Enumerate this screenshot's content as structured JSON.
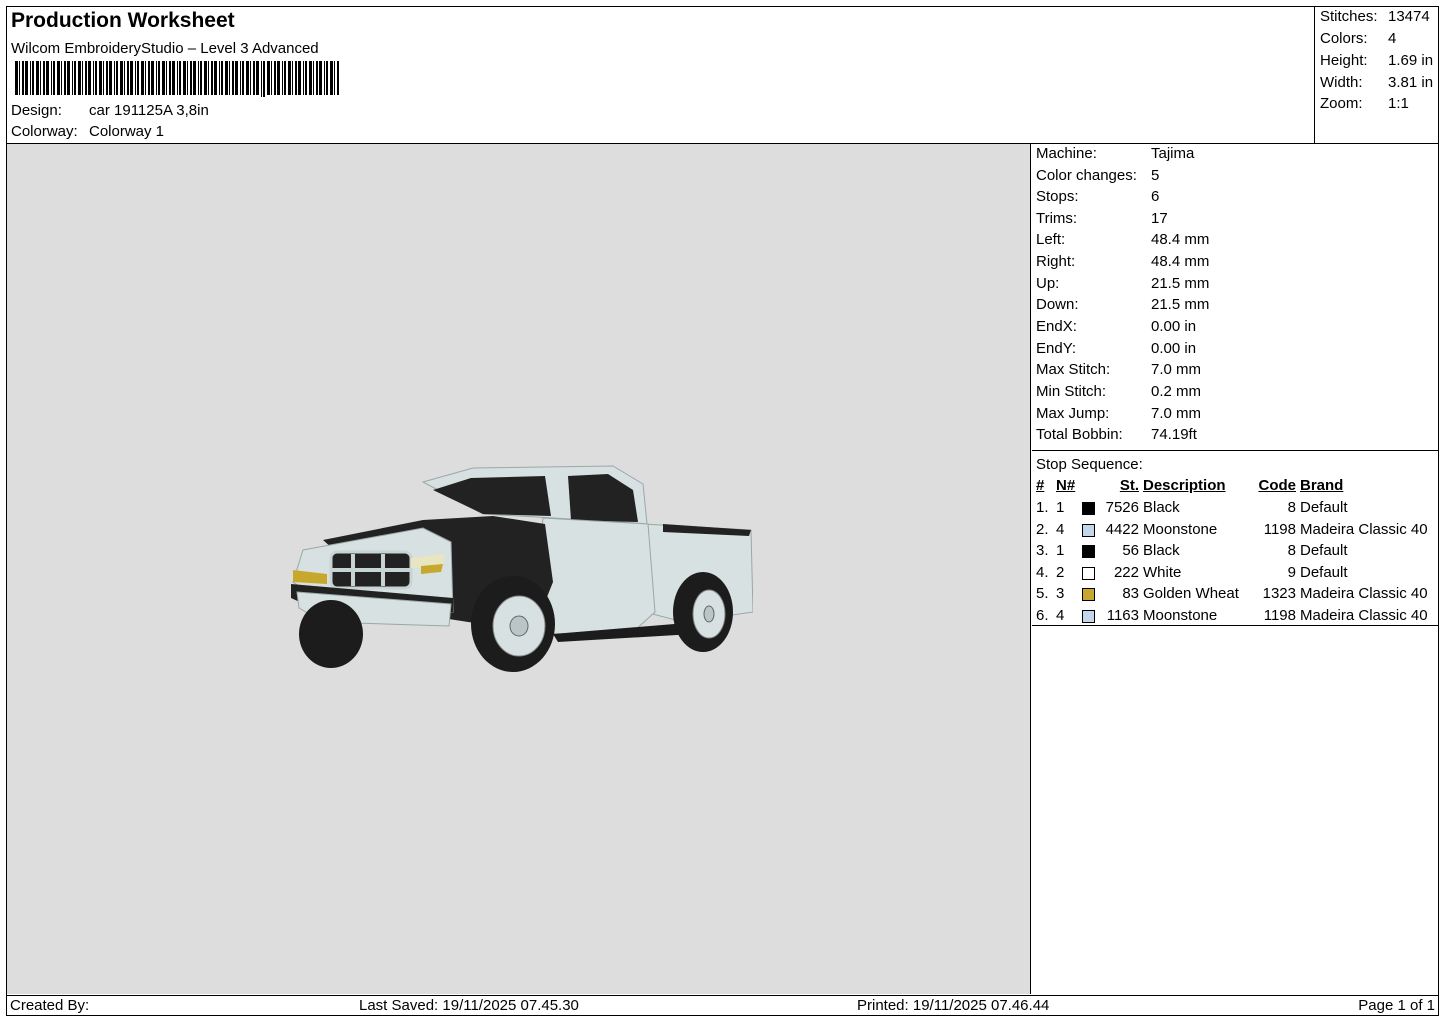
{
  "header": {
    "title": "Production Worksheet",
    "subtitle": "Wilcom EmbroideryStudio – Level 3 Advanced",
    "design_label": "Design:",
    "design_value": "car 191125A 3,8in",
    "colorway_label": "Colorway:",
    "colorway_value": "Colorway 1"
  },
  "stats": {
    "stitches_label": "Stitches:",
    "stitches": "13474",
    "colors_label": "Colors:",
    "colors": "4",
    "height_label": "Height:",
    "height": "1.69 in",
    "width_label": "Width:",
    "width": "3.81 in",
    "zoom_label": "Zoom:",
    "zoom": "1:1"
  },
  "machine": [
    {
      "label": "Machine:",
      "value": "Tajima"
    },
    {
      "label": "Color changes:",
      "value": "5"
    },
    {
      "label": "Stops:",
      "value": "6"
    },
    {
      "label": "Trims:",
      "value": "17"
    },
    {
      "label": "Left:",
      "value": "48.4 mm"
    },
    {
      "label": "Right:",
      "value": "48.4 mm"
    },
    {
      "label": "Up:",
      "value": "21.5 mm"
    },
    {
      "label": "Down:",
      "value": "21.5 mm"
    },
    {
      "label": "EndX:",
      "value": "0.00 in"
    },
    {
      "label": "EndY:",
      "value": "0.00 in"
    },
    {
      "label": "Max Stitch:",
      "value": "7.0 mm"
    },
    {
      "label": "Min Stitch:",
      "value": "0.2 mm"
    },
    {
      "label": "Max Jump:",
      "value": "7.0 mm"
    },
    {
      "label": "Total Bobbin:",
      "value": "74.19ft"
    }
  ],
  "sequence": {
    "title": "Stop Sequence:",
    "headers": {
      "num": "#",
      "n": "N#",
      "st": "St.",
      "desc": "Description",
      "code": "Code",
      "brand": "Brand"
    },
    "rows": [
      {
        "num": "1.",
        "n": "1",
        "color": "#000000",
        "st": "7526",
        "desc": "Black",
        "code": "8",
        "brand": "Default"
      },
      {
        "num": "2.",
        "n": "4",
        "color": "#c4d6ec",
        "st": "4422",
        "desc": "Moonstone",
        "code": "1198",
        "brand": "Madeira Classic 40"
      },
      {
        "num": "3.",
        "n": "1",
        "color": "#000000",
        "st": "56",
        "desc": "Black",
        "code": "8",
        "brand": "Default"
      },
      {
        "num": "4.",
        "n": "2",
        "color": "#ffffff",
        "st": "222",
        "desc": "White",
        "code": "9",
        "brand": "Default"
      },
      {
        "num": "5.",
        "n": "3",
        "color": "#c8a82c",
        "st": "83",
        "desc": "Golden Wheat",
        "code": "1323",
        "brand": "Madeira Classic 40"
      },
      {
        "num": "6.",
        "n": "4",
        "color": "#c4d6ec",
        "st": "1163",
        "desc": "Moonstone",
        "code": "1198",
        "brand": "Madeira Classic 40"
      }
    ]
  },
  "footer": {
    "created_by": "Created By:",
    "last_saved": "Last Saved: 19/11/2025 07.45.30",
    "printed": "Printed: 19/11/2025 07.46.44",
    "page": "Page 1 of 1"
  }
}
